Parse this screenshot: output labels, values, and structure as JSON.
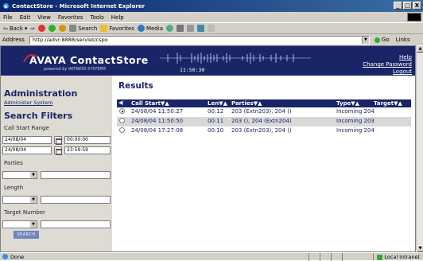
{
  "window": {
    "title": "ContactStore - Microsoft Internet Explorer",
    "buttons": [
      "_",
      "□",
      "X"
    ]
  },
  "menu": [
    "File",
    "Edit",
    "View",
    "Favorites",
    "Tools",
    "Help"
  ],
  "toolbar": {
    "back": "Back",
    "search": "Search",
    "favorites": "Favorites",
    "media": "Media"
  },
  "address": {
    "label": "Address",
    "url": "http://advr:8888/servlet/cspo",
    "go": "Go",
    "links": "Links"
  },
  "banner": {
    "brand": "AVAYA ContactStore",
    "powered": "powered by WITNESS SYSTEMS",
    "clock": "11:50:30",
    "help": "Help",
    "change_password": "Change Password",
    "logout": "Logout"
  },
  "sidebar": {
    "admin_title": "Administration",
    "admin_link": "Administer System",
    "filters_title": "Search Filters",
    "call_start_label": "Call Start Range",
    "from_date": "24/08/04",
    "from_time": "00:00:00",
    "to_date": "24/08/04",
    "to_time": "23:59:59",
    "parties_label": "Parties",
    "length_label": "Length",
    "target_label": "Target Number",
    "search_button": "SEARCH"
  },
  "results": {
    "title": "Results",
    "columns": {
      "call_start": "Call Start▼▲",
      "len": "Len▼▲",
      "parties": "Parties▼▲",
      "type": "Type▼▲",
      "target": "Target▼▲"
    },
    "rows": [
      {
        "selected": true,
        "call_start": "24/08/04 11:50:27",
        "len": "00:12",
        "parties": "203 (Extn203), 204 ()",
        "type": "Incoming 204"
      },
      {
        "selected": false,
        "call_start": "24/08/04 11:50:50",
        "len": "00:11",
        "parties": "203 (), 204 (Extn204)",
        "type": "Incoming 203"
      },
      {
        "selected": false,
        "call_start": "24/08/04 17:27:08",
        "len": "00:10",
        "parties": "203 (Extn203), 204 ()",
        "type": "Incoming 204"
      }
    ]
  },
  "status": {
    "left": "Done",
    "zone": "Local intranet"
  },
  "colors": {
    "navy": "#1a2568",
    "sidebar_bg": "#dddbd3",
    "search_btn": "#6f83bf"
  }
}
